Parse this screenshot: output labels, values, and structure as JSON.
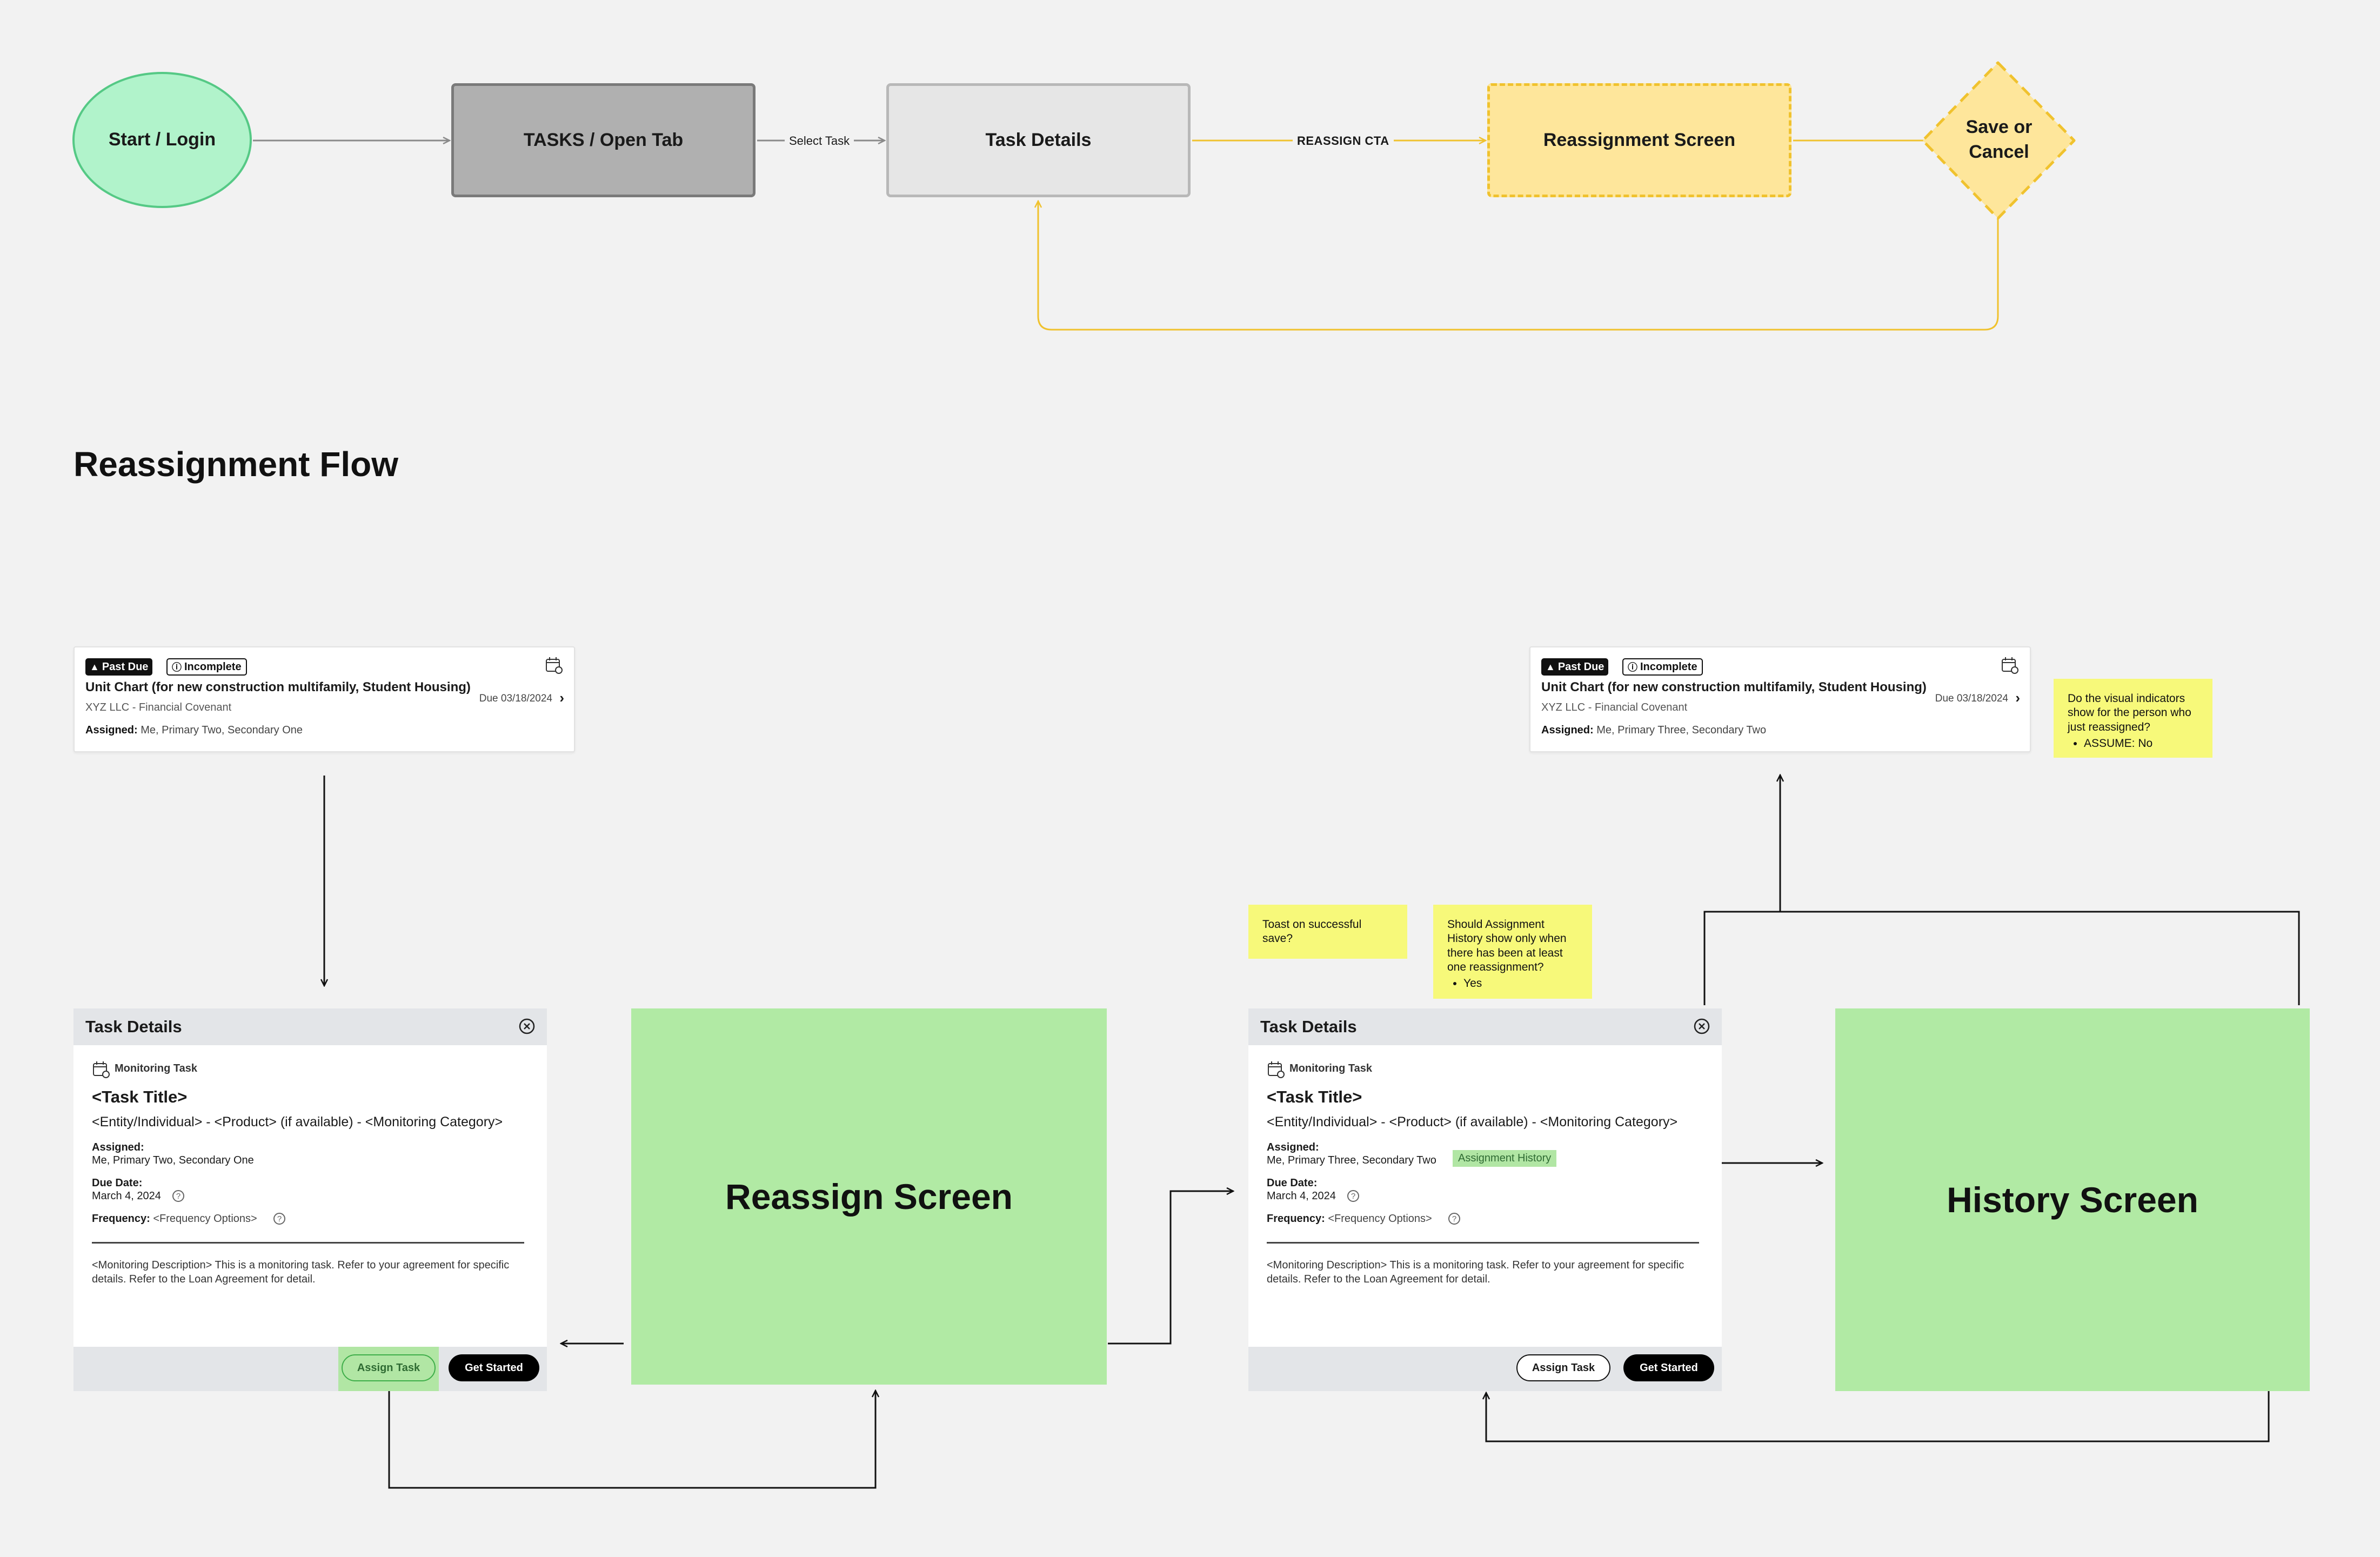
{
  "top_flow": {
    "start": "Start / Login",
    "tasks": "TASKS / Open Tab",
    "details": "Task Details",
    "reassign": "Reassignment Screen",
    "save_line1": "Save or",
    "save_line2": "Cancel",
    "edge_select": "Select Task",
    "edge_reassign": "REASSIGN CTA"
  },
  "section_title": "Reassignment Flow",
  "card_left": {
    "tag_past_due": "Past Due",
    "tag_incomplete": "Incomplete",
    "title": "Unit Chart (for new construction multifamily, Student Housing)",
    "sub": "XYZ LLC - Financial Covenant",
    "assigned_label": "Assigned:",
    "assigned_value": "Me, Primary Two, Secondary One",
    "due": "Due 03/18/2024"
  },
  "card_right": {
    "tag_past_due": "Past Due",
    "tag_incomplete": "Incomplete",
    "title": "Unit Chart (for new construction multifamily, Student Housing)",
    "sub": "XYZ LLC - Financial Covenant",
    "assigned_label": "Assigned:",
    "assigned_value": "Me, Primary Three, Secondary Two",
    "due": "Due 03/18/2024"
  },
  "stickies": {
    "visual_q": "Do the visual indicators show for the person who just reassigned?",
    "visual_a": "ASSUME: No",
    "toast": "Toast on successful save?",
    "history_q": "Should Assignment History show only when there has been at least one reassignment?",
    "history_a": "Yes"
  },
  "modal_left": {
    "header": "Task Details",
    "type": "Monitoring Task",
    "title": "<Task Title>",
    "sub": "<Entity/Individual> - <Product> (if available) - <Monitoring Category>",
    "assigned_label": "Assigned:",
    "assigned_value": "Me, Primary Two, Secondary One",
    "due_label": "Due Date:",
    "due_value": "March 4, 2024",
    "freq_label": "Frequency:",
    "freq_value": "<Frequency Options>",
    "desc": "<Monitoring Description> This is a monitoring task. Refer to your agreement for specific details. Refer to the Loan Agreement for detail.",
    "assign_btn": "Assign Task",
    "start_btn": "Get Started"
  },
  "modal_right": {
    "header": "Task Details",
    "type": "Monitoring Task",
    "title": "<Task Title>",
    "sub": "<Entity/Individual> - <Product> (if available) - <Monitoring Category>",
    "assigned_label": "Assigned:",
    "assigned_value": "Me, Primary Three, Secondary Two",
    "history_badge": "Assignment History",
    "due_label": "Due Date:",
    "due_value": "March 4, 2024",
    "freq_label": "Frequency:",
    "freq_value": "<Frequency Options>",
    "desc": "<Monitoring Description> This is a monitoring task. Refer to your agreement for specific details. Refer to the Loan Agreement for detail.",
    "assign_btn": "Assign Task",
    "start_btn": "Get Started"
  },
  "screens": {
    "reassign": "Reassign Screen",
    "history": "History Screen"
  },
  "colors": {
    "start_fill": "#b1f3cb",
    "reassign_fill": "#fee69b",
    "reassign_stroke": "#f0c22e",
    "screen_green": "#b1eaa4",
    "sticky_yellow": "#f7f97a"
  },
  "icons": [
    "warning-icon",
    "info-icon",
    "calendar-icon",
    "chevron-right-icon",
    "close-icon",
    "help-icon"
  ]
}
